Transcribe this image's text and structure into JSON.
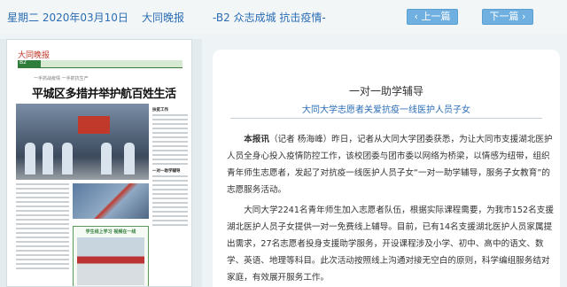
{
  "header": {
    "date": "星期二 2020年03月10日",
    "paper_name": "大同晚报",
    "section": "-B2 众志成城 抗击疫情-",
    "prev_label": "上一篇",
    "next_label": "下一篇"
  },
  "thumbnail": {
    "masthead": "大同晚报",
    "page_no": "B2",
    "subtitle": "一手抓战疫情  一手抓抗生产",
    "headline": "平城区多措并举护航百姓生活",
    "col_title1": "扶贫工作",
    "col_title2": "一对一助学辅导",
    "box_title": "学生线上学习  视频在一线"
  },
  "article": {
    "title": "一对一助学辅导",
    "subtitle": "大同大学志愿者关爱抗疫一线医护人员子女",
    "lead": "本报讯",
    "para1": "（记者 杨海峰）昨日，记者从大同大学团委获悉，为让大同市支援湖北医护人员全身心投入疫情防控工作，该校团委与团市委以网络为桥梁，以情感为纽带，组织青年师生志愿者，发起了对抗疫一线医护人员子女“一对一助学辅导，服务子女教育”的志愿服务活动。",
    "para2": "大同大学2241名青年师生加入志愿者队伍，根据实际课程需要，为我市152名支援湖北医护人员子女提供一对一免费线上辅导。目前，已有14名支援湖北医护人员家属提出需求，27名志愿者投身支援助学服务，开设课程涉及小学、初中、高中的语文、数学、英语、地理等科目。此次活动按照线上沟通对接无空白的原则，科学编组服务结对家庭，有效展开服务工作。"
  },
  "colors": {
    "accent_blue": "#2a6db5",
    "button_blue": "#6fb0e0",
    "background": "#eef4f6"
  }
}
